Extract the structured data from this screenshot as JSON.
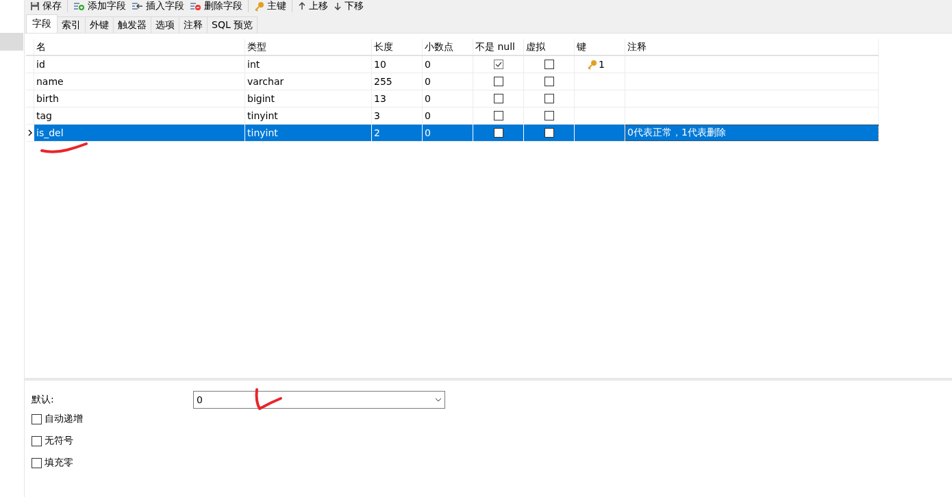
{
  "toolbar": [
    {
      "kind": "save",
      "label": "保存"
    },
    {
      "kind": "add",
      "label": "添加字段"
    },
    {
      "kind": "insert",
      "label": "插入字段"
    },
    {
      "kind": "delete",
      "label": "删除字段"
    },
    {
      "kind": "key",
      "label": "主键"
    },
    {
      "kind": "up",
      "label": "上移"
    },
    {
      "kind": "down",
      "label": "下移"
    }
  ],
  "tabs": [
    {
      "label": "字段",
      "selected": true
    },
    {
      "label": "索引",
      "selected": false
    },
    {
      "label": "外键",
      "selected": false
    },
    {
      "label": "触发器",
      "selected": false
    },
    {
      "label": "选项",
      "selected": false
    },
    {
      "label": "注释",
      "selected": false
    },
    {
      "label": "SQL 预览",
      "selected": false
    }
  ],
  "table": {
    "columns": [
      "名",
      "类型",
      "长度",
      "小数点",
      "不是 null",
      "虚拟",
      "键",
      "注释"
    ],
    "rows": [
      {
        "name": "id",
        "type": "int",
        "length": "10",
        "decimals": "0",
        "not_null": true,
        "virtual": false,
        "key": "1",
        "comment": "",
        "selected": false
      },
      {
        "name": "name",
        "type": "varchar",
        "length": "255",
        "decimals": "0",
        "not_null": false,
        "virtual": false,
        "key": "",
        "comment": "",
        "selected": false
      },
      {
        "name": "birth",
        "type": "bigint",
        "length": "13",
        "decimals": "0",
        "not_null": false,
        "virtual": false,
        "key": "",
        "comment": "",
        "selected": false
      },
      {
        "name": "tag",
        "type": "tinyint",
        "length": "3",
        "decimals": "0",
        "not_null": false,
        "virtual": false,
        "key": "",
        "comment": "",
        "selected": false
      },
      {
        "name": "is_del",
        "type": "tinyint",
        "length": "2",
        "decimals": "0",
        "not_null": false,
        "virtual": false,
        "key": "",
        "comment": "0代表正常，1代表删除",
        "selected": true
      }
    ]
  },
  "properties": {
    "default_label": "默认:",
    "default_value": "0",
    "options": [
      {
        "label": "自动递增",
        "checked": false
      },
      {
        "label": "无符号",
        "checked": false
      },
      {
        "label": "填充零",
        "checked": false
      }
    ]
  }
}
